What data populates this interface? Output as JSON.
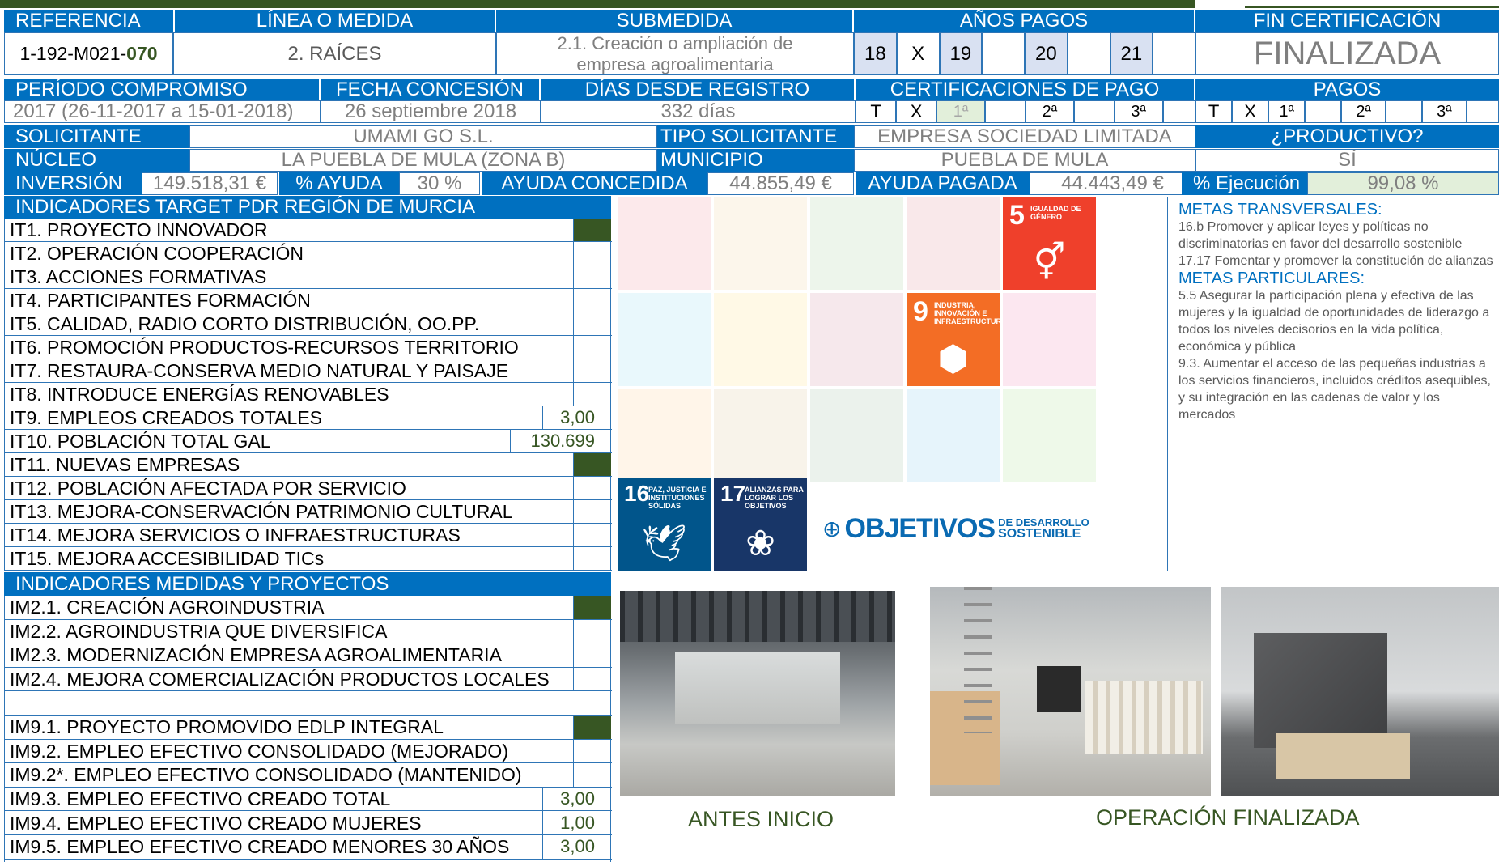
{
  "top": {
    "ref_h": "REFERENCIA",
    "linea_h": "LÍNEA O MEDIDA",
    "sub_h": "SUBMEDIDA",
    "anos_h": "AÑOS PAGOS",
    "fin_h": "FIN CERTIFICACIÓN",
    "ref_prefix": "1-192-M021-",
    "ref_bold": "070",
    "linea": "2. RAÍCES",
    "submedida": "2.1.  Creación o ampliación de empresa agroalimentaria",
    "years": [
      "18",
      "X",
      "19",
      "",
      "20",
      "",
      "21",
      ""
    ],
    "fin": "FINALIZADA"
  },
  "row2": {
    "periodo_h": "PERÍODO COMPROMISO",
    "fecha_h": "FECHA CONCESIÓN",
    "dias_h": "DÍAS DESDE REGISTRO",
    "cert_h": "CERTIFICACIONES DE PAGO",
    "pagos_h": "PAGOS",
    "periodo": "2017 (26-11-2017 a 15-01-2018)",
    "fecha": "26 septiembre 2018",
    "dias": "332 días",
    "cert": [
      "T",
      "X",
      "1ª",
      "",
      "2ª",
      "",
      "3ª",
      ""
    ],
    "pagos": [
      "T",
      "X",
      "1ª",
      "",
      "2ª",
      "",
      "3ª",
      ""
    ]
  },
  "row3": {
    "solicitante_h": "SOLICITANTE",
    "solicitante": "UMAMI GO S.L.",
    "tipo_h": "TIPO SOLICITANTE",
    "tipo": "EMPRESA SOCIEDAD LIMITADA",
    "productivo_h": "¿PRODUCTIVO?",
    "productivo": "SÍ",
    "nucleo_h": "NÚCLEO",
    "nucleo": "LA PUEBLA DE MULA (ZONA B)",
    "municipio_h": "MUNICIPIO",
    "municipio": "PUEBLA DE MULA"
  },
  "row4": {
    "inversion_h": "INVERSIÓN",
    "inversion": "149.518,31 €",
    "ayuda_pct_h": "% AYUDA",
    "ayuda_pct": "30 %",
    "concedida_h": "AYUDA CONCEDIDA",
    "concedida": "44.855,49 €",
    "pagada_h": "AYUDA PAGADA",
    "pagada": "44.443,49 €",
    "ejec_h": "% Ejecución",
    "ejec": "99,08 %"
  },
  "it_section": {
    "title": "INDICADORES TARGET PDR REGIÓN DE MURCIA",
    "rows": [
      {
        "label": "IT1. PROYECTO INNOVADOR",
        "value": "",
        "mark": true
      },
      {
        "label": "IT2. OPERACIÓN COOPERACIÓN",
        "value": "",
        "mark": false
      },
      {
        "label": "IT3. ACCIONES FORMATIVAS",
        "value": "",
        "mark": false
      },
      {
        "label": "IT4. PARTICIPANTES FORMACIÓN",
        "value": "",
        "mark": false
      },
      {
        "label": "IT5. CALIDAD, RADIO CORTO DISTRIBUCIÓN, OO.PP.",
        "value": "",
        "mark": false
      },
      {
        "label": "IT6. PROMOCIÓN PRODUCTOS-RECURSOS TERRITORIO",
        "value": "",
        "mark": false
      },
      {
        "label": "IT7. RESTAURA-CONSERVA MEDIO NATURAL Y PAISAJE",
        "value": "",
        "mark": false
      },
      {
        "label": "IT8. INTRODUCE ENERGÍAS RENOVABLES",
        "value": "",
        "mark": false
      },
      {
        "label": "IT9. EMPLEOS CREADOS TOTALES",
        "value": "3,00",
        "mark": false
      },
      {
        "label": "IT10. POBLACIÓN TOTAL GAL",
        "value": "130.699",
        "mark": false
      },
      {
        "label": "IT11. NUEVAS EMPRESAS",
        "value": "",
        "mark": true
      },
      {
        "label": "IT12. POBLACIÓN AFECTADA POR SERVICIO",
        "value": "",
        "mark": false
      },
      {
        "label": "IT13. MEJORA-CONSERVACIÓN PATRIMONIO CULTURAL",
        "value": "",
        "mark": false
      },
      {
        "label": "IT14. MEJORA SERVICIOS O INFRAESTRUCTURAS",
        "value": "",
        "mark": false
      },
      {
        "label": "IT15. MEJORA ACCESIBILIDAD TICs",
        "value": "",
        "mark": false
      }
    ]
  },
  "im_section": {
    "title": "INDICADORES MEDIDAS Y PROYECTOS",
    "rows": [
      {
        "label": "IM2.1. CREACIÓN AGROINDUSTRIA",
        "value": "",
        "mark": true
      },
      {
        "label": "IM2.2. AGROINDUSTRIA QUE DIVERSIFICA",
        "value": "",
        "mark": false
      },
      {
        "label": "IM2.3. MODERNIZACIÓN EMPRESA AGROALIMENTARIA",
        "value": "",
        "mark": false
      },
      {
        "label": "IM2.4. MEJORA COMERCIALIZACIÓN PRODUCTOS LOCALES",
        "value": "",
        "mark": false
      },
      {
        "label": "",
        "value": "",
        "mark": false
      },
      {
        "label": "IM9.1. PROYECTO PROMOVIDO EDLP INTEGRAL",
        "value": "",
        "mark": true
      },
      {
        "label": "IM9.2. EMPLEO EFECTIVO CONSOLIDADO (MEJORADO)",
        "value": "",
        "mark": false
      },
      {
        "label": "IM9.2*. EMPLEO EFECTIVO CONSOLIDADO (MANTENIDO)",
        "value": "",
        "mark": false
      },
      {
        "label": "IM9.3. EMPLEO EFECTIVO CREADO TOTAL",
        "value": "3,00",
        "mark": false
      },
      {
        "label": "IM9.4. EMPLEO EFECTIVO CREADO MUJERES",
        "value": "1,00",
        "mark": false
      },
      {
        "label": "IM9.5. EMPLEO EFECTIVO CREADO MENORES 30 AÑOS",
        "value": "3,00",
        "mark": false
      }
    ]
  },
  "sdg": {
    "active": [
      {
        "num": "5",
        "title": "IGUALDAD DE GÉNERO",
        "icon": "gender-equality-icon",
        "color": "#ef402b"
      },
      {
        "num": "9",
        "title": "INDUSTRIA, INNOVACIÓN E INFRAESTRUCTURA",
        "icon": "cubes-icon",
        "color": "#f36d25"
      },
      {
        "num": "16",
        "title": "PAZ, JUSTICIA E INSTITUCIONES SÓLIDAS",
        "icon": "dove-icon",
        "color": "#01558b"
      },
      {
        "num": "17",
        "title": "ALIANZAS PARA LOGRAR LOS OBJETIVOS",
        "icon": "rings-icon",
        "color": "#183668"
      }
    ],
    "logo_main": "OBJETIVOS",
    "logo_sub1": "DE DESARROLLO",
    "logo_sub2": "SOSTENIBLE"
  },
  "metas": {
    "transversales_h": "METAS TRANSVERSALES:",
    "transversales": [
      "16.b Promover y aplicar leyes y políticas no discriminatorias en favor del desarrollo sostenible",
      "17.17 Fomentar y promover la constitución de alianzas"
    ],
    "particulares_h": "METAS PARTICULARES:",
    "particulares": [
      "5.5 Asegurar la participación plena y efectiva de las mujeres y la igualdad de oportunidades de liderazgo a todos los niveles decisorios en la vida política, económica y pública",
      "9.3.  Aumentar el acceso de las pequeñas industrias a los servicios financieros, incluidos créditos asequibles, y su integración en las cadenas de valor y los mercados"
    ]
  },
  "photos": {
    "antes": "ANTES INICIO",
    "final": "OPERACIÓN FINALIZADA"
  },
  "colors": {
    "header": "#0070c0",
    "dark_green": "#375623",
    "border": "#2e75b6",
    "light_green": "#e2efda"
  }
}
